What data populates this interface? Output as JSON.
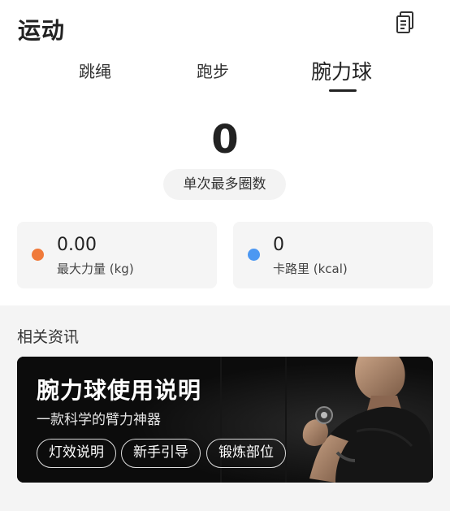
{
  "header": {
    "title": "运动",
    "icon": "document-list-icon"
  },
  "tabs": [
    {
      "label": "跳绳",
      "active": false
    },
    {
      "label": "跑步",
      "active": false
    },
    {
      "label": "腕力球",
      "active": true
    }
  ],
  "summary": {
    "value": "0",
    "metric_label": "单次最多圈数"
  },
  "stats": [
    {
      "value": "0.00",
      "label": "最大力量 (kg)",
      "dot_color": "#f07a3a"
    },
    {
      "value": "0",
      "label": "卡路里 (kcal)",
      "dot_color": "#4c98f2"
    }
  ],
  "news": {
    "section_title": "相关资讯",
    "banner": {
      "title": "腕力球使用说明",
      "subtitle": "一款科学的臂力神器",
      "tags": [
        "灯效说明",
        "新手引导",
        "锻炼部位"
      ]
    }
  },
  "colors": {
    "background": "#ffffff",
    "card": "#f5f5f5",
    "section_bg": "#f4f4f4",
    "banner_bg": "#0c0c0c",
    "orange_dot": "#f07a3a",
    "blue_dot": "#4c98f2"
  }
}
